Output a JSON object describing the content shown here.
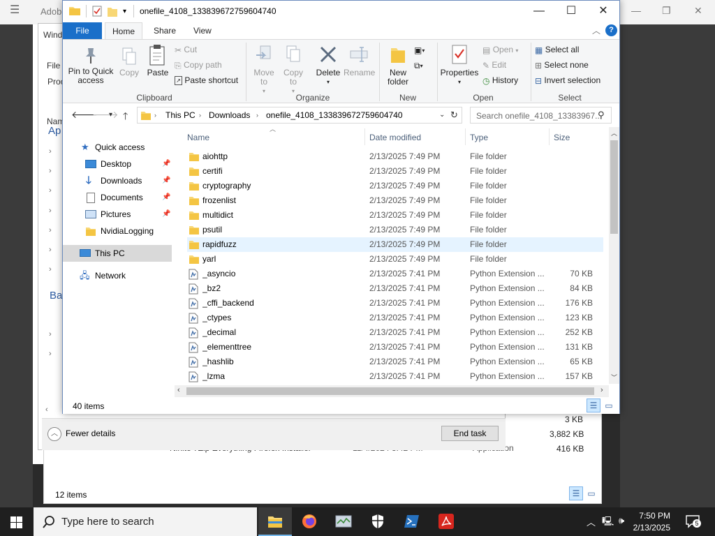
{
  "background": {
    "app_title": "Adobe",
    "taskman_fragments": [
      "Wind",
      "File",
      "Proc",
      "Nam",
      "Ap",
      "Ba"
    ],
    "taskman_footer": {
      "fewer_details": "Fewer details",
      "end_task": "End task"
    },
    "bg_explorer": {
      "visible_row_fragment": "Ninite 7Zip Everything Firefox Installer",
      "visible_row_date": "11/4/2024 3:42 PM",
      "visible_row_type": "Application",
      "sizes": [
        "3 KB",
        "3,882 KB",
        "416 KB"
      ],
      "status": "12 items"
    }
  },
  "explorer": {
    "title": "onefile_4108_133839672759604740",
    "tabs": {
      "file": "File",
      "home": "Home",
      "share": "Share",
      "view": "View"
    },
    "ribbon": {
      "clipboard": {
        "label": "Clipboard",
        "pin": "Pin to Quick access",
        "copy": "Copy",
        "paste": "Paste",
        "cut": "Cut",
        "copy_path": "Copy path",
        "paste_shortcut": "Paste shortcut"
      },
      "organize": {
        "label": "Organize",
        "move_to": "Move to",
        "copy_to": "Copy to",
        "delete": "Delete",
        "rename": "Rename"
      },
      "new": {
        "label": "New",
        "new_folder": "New folder"
      },
      "open": {
        "label": "Open",
        "properties": "Properties",
        "open": "Open",
        "edit": "Edit",
        "history": "History"
      },
      "select": {
        "label": "Select",
        "select_all": "Select all",
        "select_none": "Select none",
        "invert": "Invert selection"
      }
    },
    "address": {
      "crumbs": [
        "This PC",
        "Downloads",
        "onefile_4108_133839672759604740"
      ],
      "search_placeholder": "Search onefile_4108_13383967..."
    },
    "nav": {
      "quick_access": "Quick access",
      "items": [
        {
          "label": "Desktop",
          "pinned": true
        },
        {
          "label": "Downloads",
          "pinned": true
        },
        {
          "label": "Documents",
          "pinned": true
        },
        {
          "label": "Pictures",
          "pinned": true
        },
        {
          "label": "NvidiaLogging",
          "pinned": false
        }
      ],
      "this_pc": "This PC",
      "network": "Network"
    },
    "columns": {
      "name": "Name",
      "date": "Date modified",
      "type": "Type",
      "size": "Size"
    },
    "rows": [
      {
        "name": "aiohttp",
        "date": "2/13/2025 7:49 PM",
        "type": "File folder",
        "size": "",
        "kind": "folder"
      },
      {
        "name": "certifi",
        "date": "2/13/2025 7:49 PM",
        "type": "File folder",
        "size": "",
        "kind": "folder"
      },
      {
        "name": "cryptography",
        "date": "2/13/2025 7:49 PM",
        "type": "File folder",
        "size": "",
        "kind": "folder"
      },
      {
        "name": "frozenlist",
        "date": "2/13/2025 7:49 PM",
        "type": "File folder",
        "size": "",
        "kind": "folder"
      },
      {
        "name": "multidict",
        "date": "2/13/2025 7:49 PM",
        "type": "File folder",
        "size": "",
        "kind": "folder"
      },
      {
        "name": "psutil",
        "date": "2/13/2025 7:49 PM",
        "type": "File folder",
        "size": "",
        "kind": "folder"
      },
      {
        "name": "rapidfuzz",
        "date": "2/13/2025 7:49 PM",
        "type": "File folder",
        "size": "",
        "kind": "folder"
      },
      {
        "name": "yarl",
        "date": "2/13/2025 7:49 PM",
        "type": "File folder",
        "size": "",
        "kind": "folder"
      },
      {
        "name": "_asyncio",
        "date": "2/13/2025 7:41 PM",
        "type": "Python Extension ...",
        "size": "70 KB",
        "kind": "pyd"
      },
      {
        "name": "_bz2",
        "date": "2/13/2025 7:41 PM",
        "type": "Python Extension ...",
        "size": "84 KB",
        "kind": "pyd"
      },
      {
        "name": "_cffi_backend",
        "date": "2/13/2025 7:41 PM",
        "type": "Python Extension ...",
        "size": "176 KB",
        "kind": "pyd"
      },
      {
        "name": "_ctypes",
        "date": "2/13/2025 7:41 PM",
        "type": "Python Extension ...",
        "size": "123 KB",
        "kind": "pyd"
      },
      {
        "name": "_decimal",
        "date": "2/13/2025 7:41 PM",
        "type": "Python Extension ...",
        "size": "252 KB",
        "kind": "pyd"
      },
      {
        "name": "_elementtree",
        "date": "2/13/2025 7:41 PM",
        "type": "Python Extension ...",
        "size": "131 KB",
        "kind": "pyd"
      },
      {
        "name": "_hashlib",
        "date": "2/13/2025 7:41 PM",
        "type": "Python Extension ...",
        "size": "65 KB",
        "kind": "pyd"
      },
      {
        "name": "_lzma",
        "date": "2/13/2025 7:41 PM",
        "type": "Python Extension ...",
        "size": "157 KB",
        "kind": "pyd"
      }
    ],
    "hover_row": "rapidfuzz",
    "status": "40 items"
  },
  "taskbar": {
    "search_placeholder": "Type here to search",
    "time": "7:50 PM",
    "date": "2/13/2025",
    "notifications": "5",
    "apps": [
      "file-explorer",
      "firefox",
      "task-manager",
      "windows-security",
      "powershell",
      "acrobat"
    ]
  },
  "colors": {
    "accent": "#1a6fc9",
    "folder": "#f8d775",
    "taskbar": "#1f1f1f",
    "selection": "#cce8ff"
  }
}
